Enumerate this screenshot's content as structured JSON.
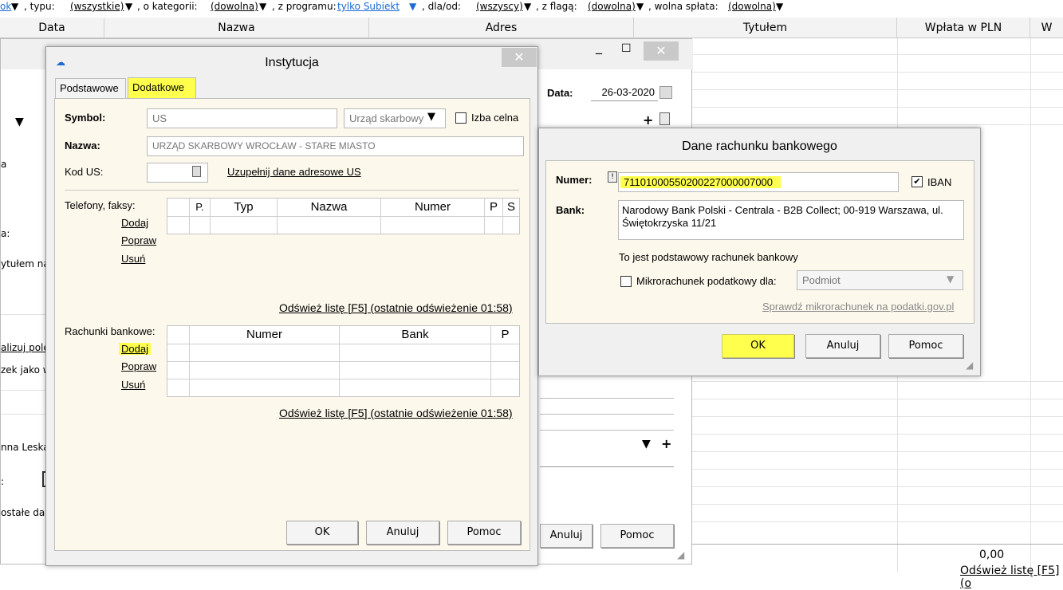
{
  "filterbar": {
    "item1": "ok",
    "typu_label": ", typu:",
    "typu_value": "(wszystkie)",
    "kategorii_label": ", o kategorii:",
    "kategorii_value": "(dowolna)",
    "programu_label": ", z programu:",
    "programu_value": "tylko Subiekt",
    "dlaod_label": ", dla/od:",
    "dlaod_value": "(wszyscy)",
    "flaga_label": ", z flagą:",
    "flaga_value": "(dowolna)",
    "splata_label": ", wolna spłata:",
    "splata_value": "(dowolna)"
  },
  "grid": {
    "columns": [
      "Data",
      "Nazwa",
      "Adres",
      "Tytułem",
      "Wpłata w PLN",
      "W"
    ],
    "total": "0,00",
    "footer_link": "Odśwież listę [F5] (o"
  },
  "back_dialog": {
    "data_label": "Data:",
    "data_value": "26-03-2020",
    "left_fragments": [
      "ytułem na",
      "alizuj pole",
      "zek jako w",
      "nna Leska",
      "ostałe dan",
      "a:",
      "a",
      ":"
    ],
    "cancel": "Anuluj",
    "help": "Pomoc",
    "minimize": "_",
    "maximize": "☐",
    "close": "✕"
  },
  "inst": {
    "title": "Instytucja",
    "tab_basic": "Podstawowe",
    "tab_extra": "Dodatkowe",
    "symbol_label": "Symbol:",
    "symbol_value": "US",
    "type_value": "Urząd skarbowy",
    "izba_label": "Izba celna",
    "nazwa_label": "Nazwa:",
    "nazwa_value": "URZĄD SKARBOWY WROCŁAW - STARE MIASTO",
    "kodus_label": "Kod US:",
    "kodus_link": "Uzupełnij dane adresowe US",
    "phones_label": "Telefony, faksy:",
    "phones_cols": [
      "P.",
      "Typ",
      "Nazwa",
      "Numer",
      "P",
      "S"
    ],
    "add": "Dodaj",
    "edit": "Popraw",
    "remove": "Usuń",
    "refresh": "Odśwież listę [F5] (ostatnie odświeżenie 01:58)",
    "accounts_label": "Rachunki bankowe:",
    "accounts_cols": [
      "Numer",
      "Bank",
      "P"
    ],
    "ok": "OK",
    "cancel": "Anuluj",
    "help": "Pomoc",
    "close": "✕"
  },
  "rach": {
    "title": "Dane rachunku bankowego",
    "numer_label": "Numer:",
    "numer_value": "71101000550200227000007000",
    "iban_label": "IBAN",
    "iban_checked": true,
    "bank_label": "Bank:",
    "bank_value": "Narodowy Bank Polski  - Centrala - B2B Collect; 00-919 Warszawa, ul. Świętokrzyska 11/21",
    "primary_info": "To jest podstawowy rachunek bankowy",
    "micro_label": "Mikrorachunek podatkowy dla:",
    "micro_value": "Podmiot",
    "check_link": "Sprawdź mikrorachunek na podatki.gov.pl",
    "ok": "OK",
    "cancel": "Anuluj",
    "help": "Pomoc"
  },
  "colors": {
    "highlight": "#ffff4d",
    "panel_bg": "#fdf8ec",
    "dialog_bg": "#f0f0f0",
    "link": "#1a6ad4"
  }
}
